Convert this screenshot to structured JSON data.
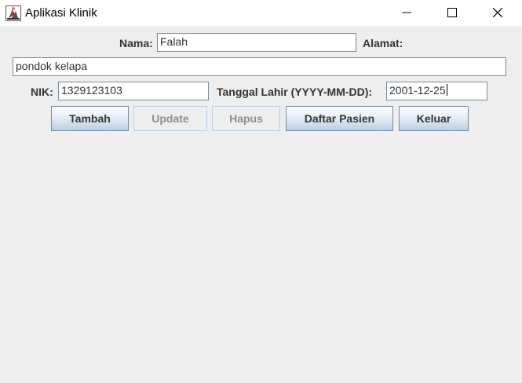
{
  "window": {
    "title": "Aplikasi Klinik",
    "icons": [
      "java-app-icon",
      "minimize-icon",
      "maximize-icon",
      "close-icon"
    ]
  },
  "form": {
    "nama_label": "Nama:",
    "nama_value": "Falah",
    "alamat_label": "Alamat:",
    "alamat_value": "pondok kelapa",
    "nik_label": "NIK:",
    "nik_value": "1329123103",
    "tanggal_label": "Tanggal Lahir (YYYY-MM-DD):",
    "tanggal_value": "2001-12-25"
  },
  "buttons": {
    "tambah": "Tambah",
    "update": "Update",
    "hapus": "Hapus",
    "daftar": "Daftar Pasien",
    "keluar": "Keluar"
  },
  "colors": {
    "background": "#eeeeee",
    "field_border": "#7a8a99",
    "button_gradient_bottom": "#b8cfe5",
    "disabled_text": "#8e8e8e"
  }
}
